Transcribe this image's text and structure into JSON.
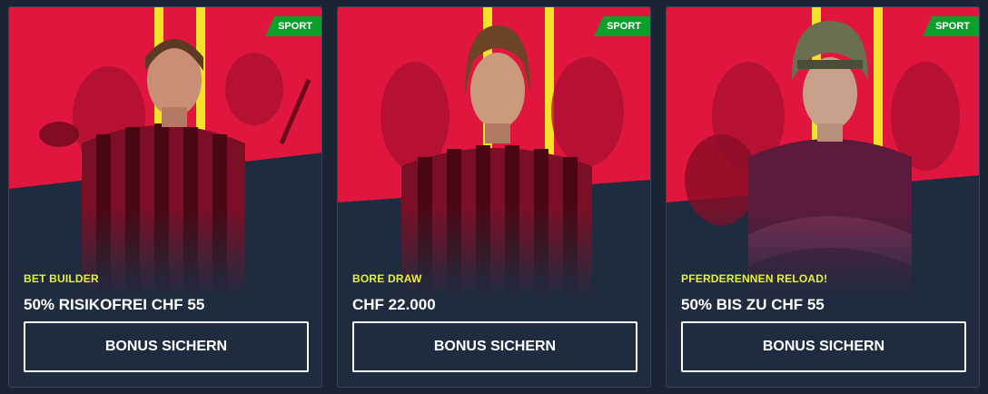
{
  "cards": [
    {
      "badge": "SPORT",
      "category": "BET BUILDER",
      "offer": "50% RISIKOFREI CHF 55",
      "button_label": "BONUS SICHERN"
    },
    {
      "badge": "SPORT",
      "category": "BORE DRAW",
      "offer": "CHF 22.000",
      "button_label": "BONUS SICHERN"
    },
    {
      "badge": "SPORT",
      "category": "PFERDERENNEN RELOAD!",
      "offer": "50% BIS ZU CHF 55",
      "button_label": "BONUS SICHERN"
    }
  ],
  "colors": {
    "page_bg": "#1a2433",
    "card_bg": "#1f2c40",
    "art_red": "#e0163f",
    "accent_yellow": "#f2e22a",
    "badge_green": "#0c9f2a",
    "category_text": "#e6f23a"
  }
}
